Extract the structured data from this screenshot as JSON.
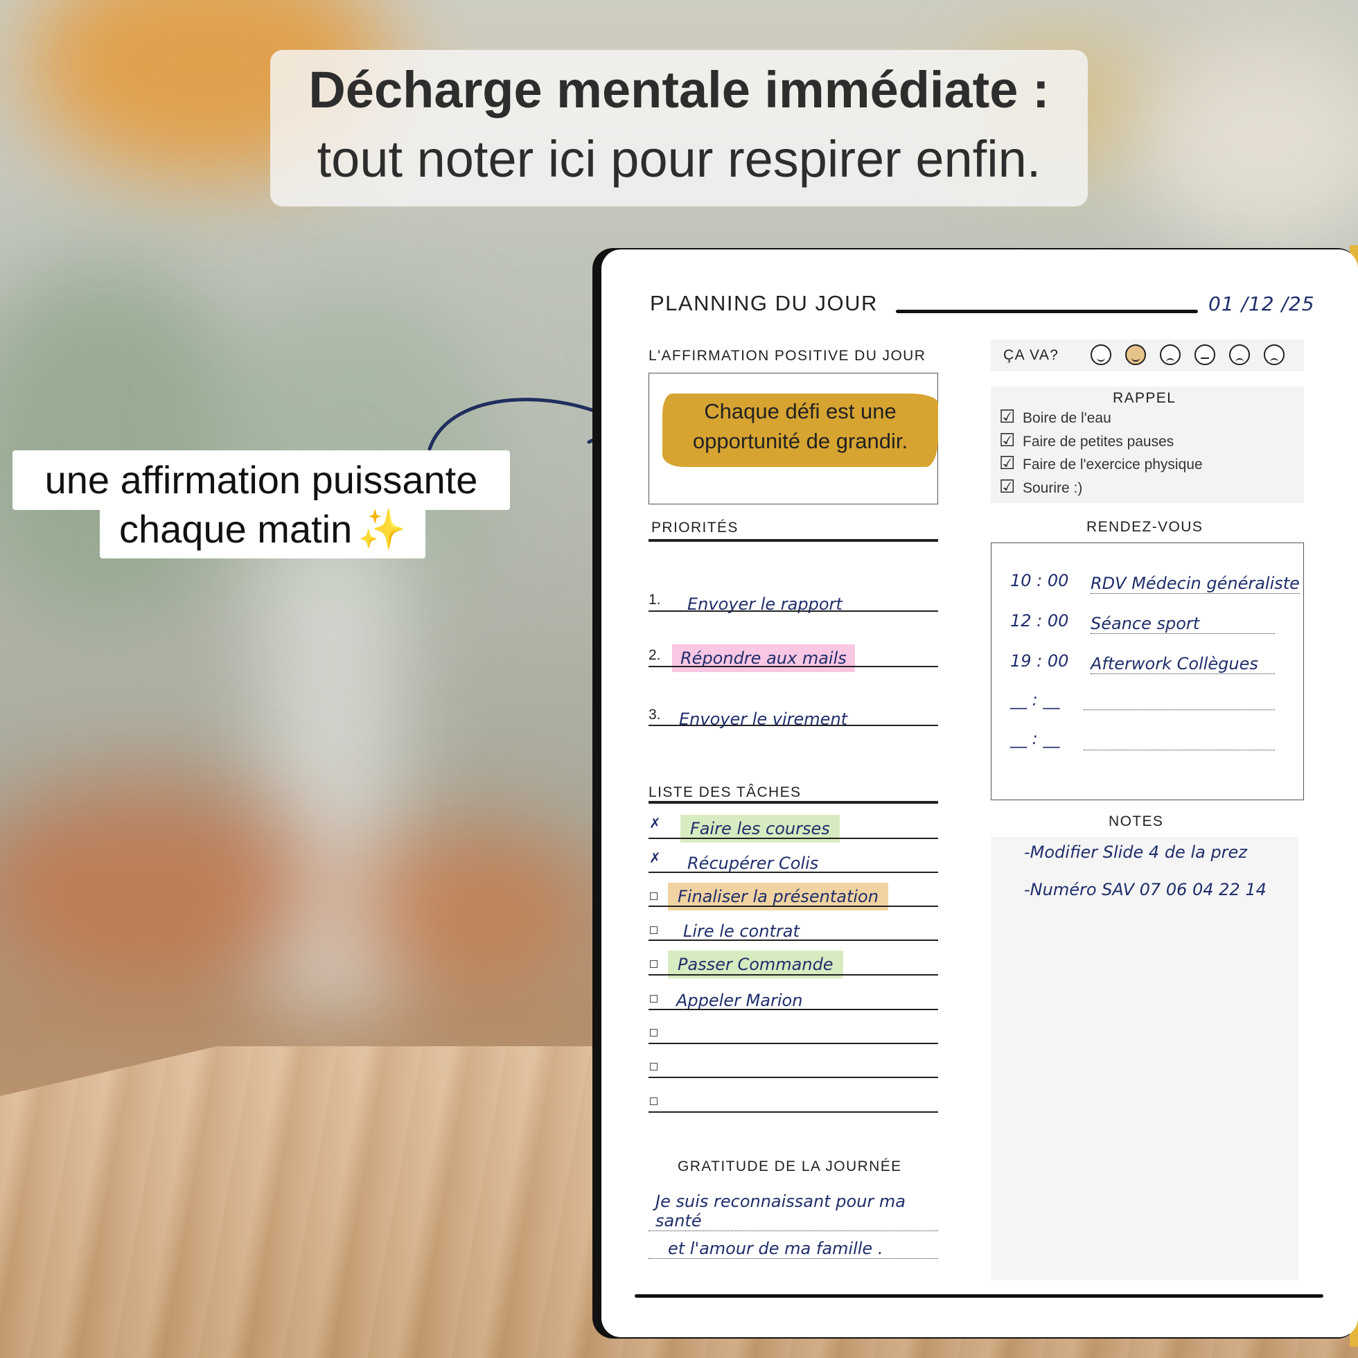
{
  "headline": {
    "line1": "Décharge mentale immédiate :",
    "line2": "tout noter ici pour respirer enfin."
  },
  "callout": {
    "line1": "une affirmation puissante",
    "line2": "chaque matin",
    "sparkle": "✨"
  },
  "planner": {
    "title": "PLANNING DU JOUR",
    "date": "01 /12 /25",
    "affirmation": {
      "label": "L'AFFIRMATION POSITIVE DU JOUR",
      "text": "Chaque défi est une opportunité de grandir."
    },
    "mood": {
      "label": "ÇA VA?",
      "faces": [
        "grinning-face-icon",
        "smiling-face-icon",
        "pensive-face-icon",
        "neutral-face-icon",
        "tired-face-icon",
        "weary-face-icon"
      ],
      "selected_index": 1
    },
    "rappel": {
      "label": "RAPPEL",
      "items": [
        "Boire de l'eau",
        "Faire de petites pauses",
        "Faire de l'exercice physique",
        "Sourire :)"
      ]
    },
    "priorites": {
      "label": "PRIORITÉS",
      "items": [
        {
          "num": "1.",
          "text": "Envoyer le rapport"
        },
        {
          "num": "2.",
          "text": "Répondre aux mails"
        },
        {
          "num": "3.",
          "text": "Envoyer le virement"
        }
      ]
    },
    "rendez_vous": {
      "label": "RENDEZ-VOUS",
      "items": [
        {
          "time": "10 : 00",
          "text": "RDV Médecin généraliste"
        },
        {
          "time": "12 : 00",
          "text": "Séance sport"
        },
        {
          "time": "19 : 00",
          "text": "Afterwork Collègues"
        },
        {
          "time": "__ : __",
          "text": ""
        },
        {
          "time": "__ : __",
          "text": ""
        }
      ]
    },
    "taches": {
      "label": "LISTE DES TÂCHES",
      "check_mark": "✗",
      "items": [
        {
          "text": "Faire les courses",
          "done": true
        },
        {
          "text": "Récupérer Colis",
          "done": true
        },
        {
          "text": "Finaliser la présentation",
          "done": false
        },
        {
          "text": "Lire le contrat",
          "done": false
        },
        {
          "text": "Passer Commande",
          "done": false
        },
        {
          "text": "Appeler Marion",
          "done": false
        },
        {
          "text": "",
          "done": false
        },
        {
          "text": "",
          "done": false
        },
        {
          "text": "",
          "done": false
        }
      ]
    },
    "notes": {
      "label": "NOTES",
      "items": [
        "-Modifier Slide 4 de la prez",
        "-Numéro SAV 07 06 04 22 14"
      ]
    },
    "gratitude": {
      "label": "GRATITUDE DE LA JOURNÉE",
      "lines": [
        "Je suis reconnaissant pour ma santé",
        "et l'amour de ma famille ."
      ]
    }
  },
  "colors": {
    "ink": "#1f2e6b",
    "brush_yellow": "#d7a431",
    "highlight_pink": "#f9c6e3",
    "highlight_green": "#d7ebc0",
    "highlight_orange": "#f0d3a1"
  }
}
